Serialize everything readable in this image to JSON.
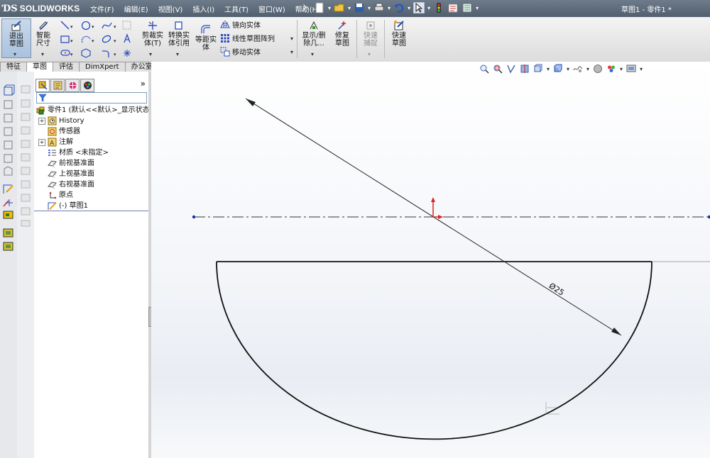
{
  "app": {
    "brand": "SOLIDWORKS",
    "document_title": "草图1 - 零件1 *"
  },
  "menu": [
    "文件(F)",
    "编辑(E)",
    "视图(V)",
    "插入(I)",
    "工具(T)",
    "窗口(W)",
    "帮助(H)"
  ],
  "command_manager": {
    "exit_sketch": "退出草图",
    "smart_dimension": "智能尺寸",
    "trim": "剪裁实体(T)",
    "convert": "转换实体引用",
    "offset": "等距实体",
    "mirror": "镜向实体",
    "linear_pattern": "线性草图阵列",
    "move": "移动实体",
    "display_delete": "显示/删除几...",
    "repair": "修复草图",
    "rapid_snap": "快速捕捉",
    "rapid_sketch": "快速草图"
  },
  "tabs": [
    {
      "label": "特征",
      "active": false
    },
    {
      "label": "草图",
      "active": true
    },
    {
      "label": "评估",
      "active": false
    },
    {
      "label": "DimXpert",
      "active": false
    },
    {
      "label": "办公室产品",
      "active": false
    }
  ],
  "feature_tree": {
    "root": "零件1  (默认<<默认>_显示状态",
    "items": [
      {
        "label": "History",
        "icon": "history-folder-icon",
        "expandable": true
      },
      {
        "label": "传感器",
        "icon": "sensor-icon",
        "expandable": false
      },
      {
        "label": "注解",
        "icon": "annotation-icon",
        "expandable": true
      },
      {
        "label": "材质 <未指定>",
        "icon": "material-icon",
        "expandable": false
      },
      {
        "label": "前视基准面",
        "icon": "plane-icon",
        "expandable": false
      },
      {
        "label": "上视基准面",
        "icon": "plane-icon",
        "expandable": false
      },
      {
        "label": "右视基准面",
        "icon": "plane-icon",
        "expandable": false
      },
      {
        "label": "原点",
        "icon": "origin-icon",
        "expandable": false
      },
      {
        "label": "(-) 草图1",
        "icon": "sketch-icon",
        "expandable": false
      }
    ]
  },
  "sketch": {
    "dimension_label": "Ø25"
  },
  "colors": {
    "titlebar": "#5d6a79",
    "origin_red": "#e02020",
    "sketch_line": "#111111",
    "point_blue": "#1a2bb8"
  }
}
